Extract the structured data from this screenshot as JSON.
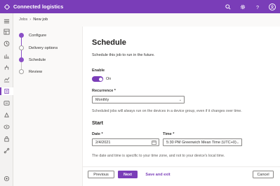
{
  "app": {
    "title": "Connected logistics"
  },
  "header": {
    "icons": [
      "search-icon",
      "gear-icon",
      "help-icon",
      "user-icon"
    ]
  },
  "breadcrumb": {
    "root": "Jobs",
    "separator": "›",
    "current": "New job"
  },
  "steps": [
    {
      "label": "Configure",
      "state": "done"
    },
    {
      "label": "Delivery options",
      "state": "pending"
    },
    {
      "label": "Schedule",
      "state": "current"
    },
    {
      "label": "Review",
      "state": "pending"
    }
  ],
  "form": {
    "title": "Schedule",
    "description": "Schedule this job to run in the future.",
    "enable": {
      "label": "Enable",
      "state_text": "On",
      "on": true
    },
    "recurrence": {
      "label": "Recurrence *",
      "value": "Monthly",
      "hint": "Scheduled jobs will always run on the devices in a device group, even if it changes over time."
    },
    "start": {
      "title": "Start",
      "date_label": "Date *",
      "date_value": "2/4/2021",
      "time_label": "Time *",
      "time_value": "5:30 PM Greenwich Mean Time (UTC+0)",
      "hint": "The date and time is specific to your time zone, and not to your device's local time."
    }
  },
  "footer": {
    "previous": "Previous",
    "next": "Next",
    "save_exit": "Save and exit",
    "cancel": "Cancel"
  },
  "colors": {
    "accent": "#7a3db8",
    "top_bar": "#7a3db8"
  }
}
